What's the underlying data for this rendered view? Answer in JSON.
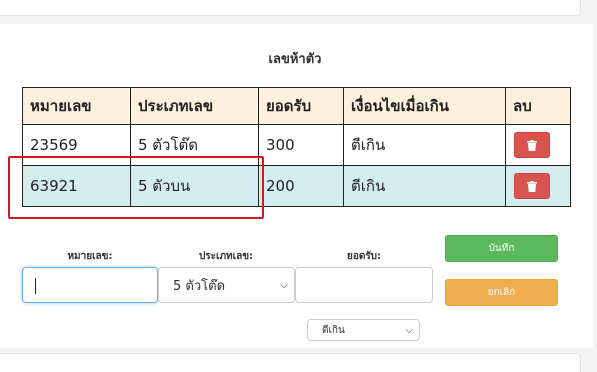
{
  "section_title": "เลขห้าตัว",
  "table": {
    "headers": [
      "หมายเลข",
      "ประเภทเลข",
      "ยอดรับ",
      "เงื่อนไขเมื่อเกิน",
      "ลบ"
    ],
    "rows": [
      {
        "number": "23569",
        "type": "5 ตัวโต๊ด",
        "amount": "300",
        "condition": "ตีเกิน",
        "highlighted": false
      },
      {
        "number": "63921",
        "type": "5 ตัวบน",
        "amount": "200",
        "condition": "ตีเกิน",
        "highlighted": true
      }
    ],
    "delete_icon": "trash-icon"
  },
  "form": {
    "number_label": "หมายเลข:",
    "number_value": "",
    "type_label": "ประเภทเลข:",
    "type_selected": "5 ตัวโต๊ด",
    "amount_label": "ยอดรับ:",
    "amount_value": "",
    "condition_selected": "ตีเกิน",
    "save_label": "บันทึก",
    "cancel_label": "ยกเลิก"
  },
  "colors": {
    "header_bg": "#fdf0dc",
    "highlight_row_bg": "#d4edef",
    "delete_button": "#d9534f",
    "save_button": "#5cb85c",
    "cancel_button": "#f0ad4e",
    "annotation_box": "#d0191f"
  }
}
